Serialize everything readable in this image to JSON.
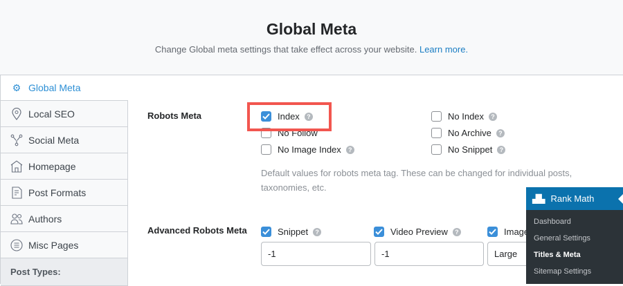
{
  "header": {
    "title": "Global Meta",
    "subtitle": "Change Global meta settings that take effect across your website.",
    "learn_more": "Learn more."
  },
  "sidebar": {
    "items": [
      {
        "label": "Global Meta",
        "icon": "gear-icon",
        "active": true
      },
      {
        "label": "Local SEO",
        "icon": "location-pin-icon"
      },
      {
        "label": "Social Meta",
        "icon": "share-nodes-icon"
      },
      {
        "label": "Homepage",
        "icon": "home-icon"
      },
      {
        "label": "Post Formats",
        "icon": "document-icon"
      },
      {
        "label": "Authors",
        "icon": "users-icon"
      },
      {
        "label": "Misc Pages",
        "icon": "list-circle-icon"
      }
    ],
    "post_types": "Post Types:"
  },
  "robots": {
    "label": "Robots Meta",
    "options": [
      {
        "label": "Index",
        "checked": true
      },
      {
        "label": "No Follow",
        "checked": false
      },
      {
        "label": "No Image Index",
        "checked": false
      },
      {
        "label": "No Index",
        "checked": false
      },
      {
        "label": "No Archive",
        "checked": false
      },
      {
        "label": "No Snippet",
        "checked": false
      }
    ],
    "description": "Default values for robots meta tag. These can be changed for individual posts, taxonomies, etc."
  },
  "advanced": {
    "label": "Advanced Robots Meta",
    "options": [
      {
        "label": "Snippet",
        "checked": true,
        "value": "-1"
      },
      {
        "label": "Video Preview",
        "checked": true,
        "value": "-1"
      },
      {
        "label": "Image",
        "checked": true,
        "value": "Large"
      }
    ]
  },
  "rankmath_menu": {
    "title": "Rank Math",
    "items": [
      "Dashboard",
      "General Settings",
      "Titles & Meta",
      "Sitemap Settings"
    ],
    "current": "Titles & Meta"
  },
  "colors": {
    "accent": "#2d8fd5",
    "highlight": "#f2564f",
    "menu_blue": "#0b72ad"
  }
}
